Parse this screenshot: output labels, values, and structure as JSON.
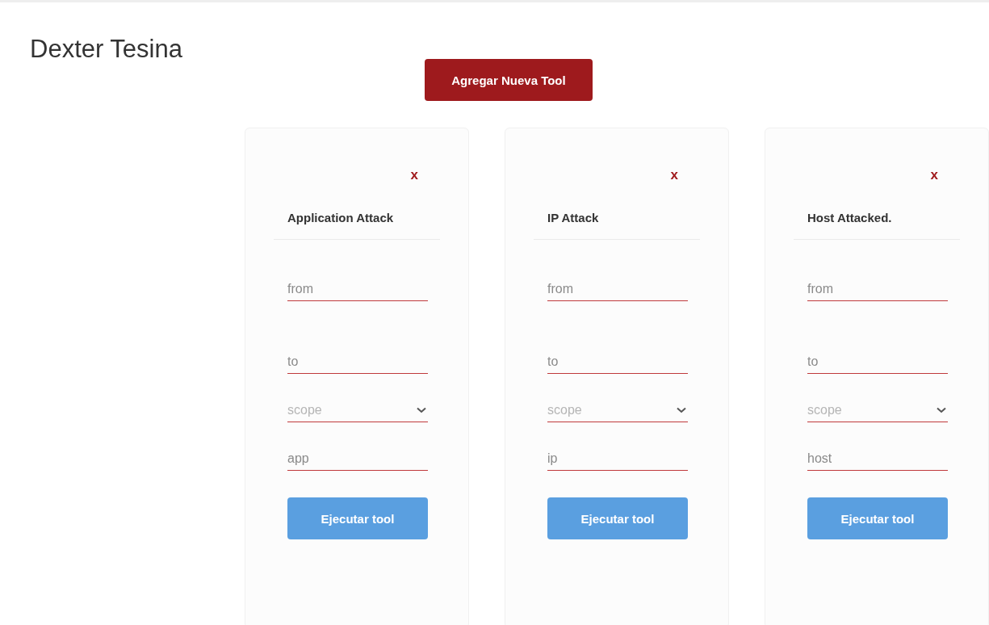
{
  "title": "Dexter Tesina",
  "add_button": "Agregar Nueva Tool",
  "cards": [
    {
      "close": "x",
      "title": "Application Attack",
      "fields": [
        {
          "kind": "text",
          "placeholder": "from"
        },
        {
          "kind": "text",
          "placeholder": "to"
        },
        {
          "kind": "select",
          "placeholder": "scope"
        },
        {
          "kind": "text",
          "placeholder": "app"
        }
      ],
      "button": "Ejecutar tool"
    },
    {
      "close": "x",
      "title": "IP Attack",
      "fields": [
        {
          "kind": "text",
          "placeholder": "from"
        },
        {
          "kind": "text",
          "placeholder": "to"
        },
        {
          "kind": "select",
          "placeholder": "scope"
        },
        {
          "kind": "text",
          "placeholder": "ip"
        }
      ],
      "button": "Ejecutar tool"
    },
    {
      "close": "x",
      "title": "Host Attacked.",
      "fields": [
        {
          "kind": "text",
          "placeholder": "from"
        },
        {
          "kind": "text",
          "placeholder": "to"
        },
        {
          "kind": "select",
          "placeholder": "scope"
        },
        {
          "kind": "text",
          "placeholder": "host"
        }
      ],
      "button": "Ejecutar tool"
    }
  ]
}
